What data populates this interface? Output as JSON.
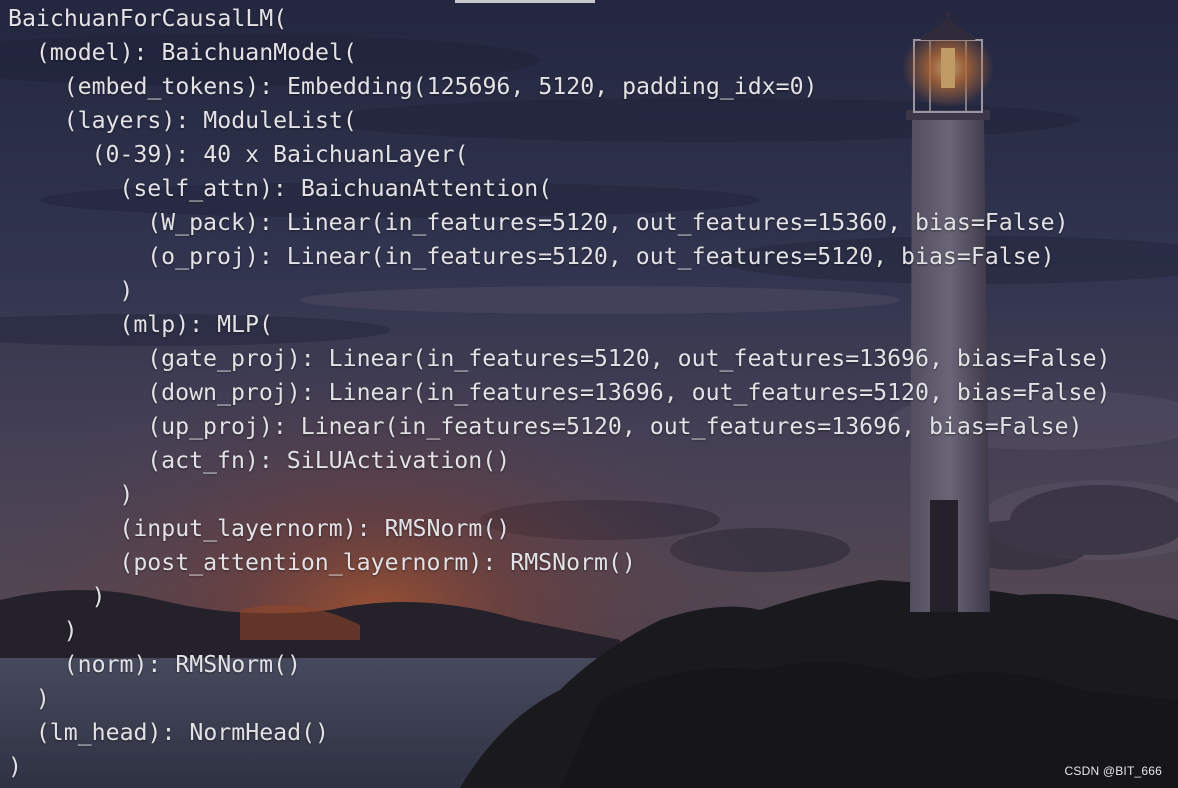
{
  "terminal": {
    "lines": [
      {
        "indent": 0,
        "text": "BaichuanForCausalLM("
      },
      {
        "indent": 2,
        "text": "(model): BaichuanModel("
      },
      {
        "indent": 4,
        "text": "(embed_tokens): Embedding(125696, 5120, padding_idx=0)"
      },
      {
        "indent": 4,
        "text": "(layers): ModuleList("
      },
      {
        "indent": 6,
        "text": "(0-39): 40 x BaichuanLayer("
      },
      {
        "indent": 8,
        "text": "(self_attn): BaichuanAttention("
      },
      {
        "indent": 10,
        "text": "(W_pack): Linear(in_features=5120, out_features=15360, bias=False)"
      },
      {
        "indent": 10,
        "text": "(o_proj): Linear(in_features=5120, out_features=5120, bias=False)"
      },
      {
        "indent": 8,
        "text": ")"
      },
      {
        "indent": 8,
        "text": "(mlp): MLP("
      },
      {
        "indent": 10,
        "text": "(gate_proj): Linear(in_features=5120, out_features=13696, bias=False)"
      },
      {
        "indent": 10,
        "text": "(down_proj): Linear(in_features=13696, out_features=5120, bias=False)"
      },
      {
        "indent": 10,
        "text": "(up_proj): Linear(in_features=5120, out_features=13696, bias=False)"
      },
      {
        "indent": 10,
        "text": "(act_fn): SiLUActivation()"
      },
      {
        "indent": 8,
        "text": ")"
      },
      {
        "indent": 8,
        "text": "(input_layernorm): RMSNorm()"
      },
      {
        "indent": 8,
        "text": "(post_attention_layernorm): RMSNorm()"
      },
      {
        "indent": 6,
        "text": ")"
      },
      {
        "indent": 4,
        "text": ")"
      },
      {
        "indent": 4,
        "text": "(norm): RMSNorm()"
      },
      {
        "indent": 2,
        "text": ")"
      },
      {
        "indent": 2,
        "text": "(lm_head): NormHead()"
      },
      {
        "indent": 0,
        "text": ")"
      }
    ]
  },
  "watermark": "CSDN @BIT_666",
  "colors": {
    "text": "#e2e2e6",
    "sky_top": "#2b3050",
    "sky_mid": "#55506a",
    "glow": "#d8582a",
    "rock": "#1c1a1c"
  }
}
